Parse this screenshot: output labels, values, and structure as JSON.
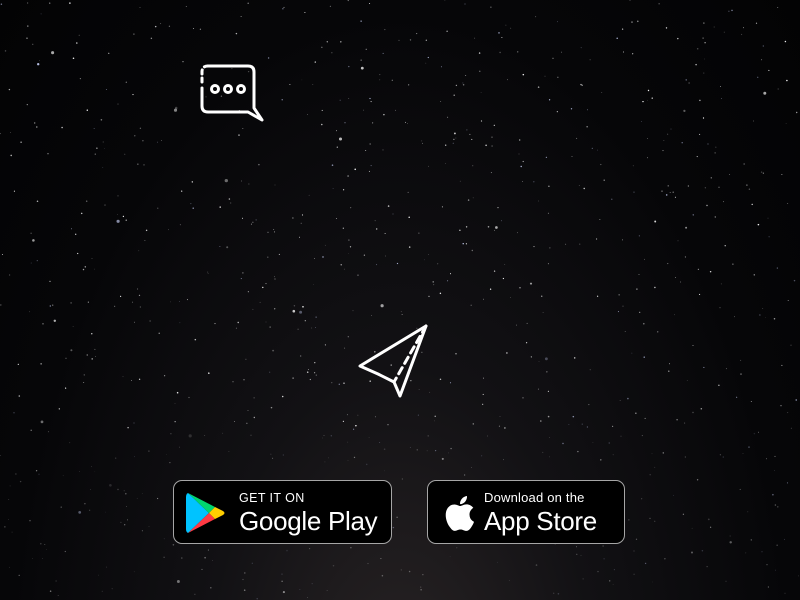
{
  "icons": {
    "chat": "chat-bubble-icon",
    "plane": "paper-plane-icon",
    "google_logo": "google-play-logo-icon",
    "apple_logo": "apple-logo-icon"
  },
  "badges": {
    "google_play": {
      "small_label": "GET IT ON",
      "big_label": "Google Play"
    },
    "app_store": {
      "small_label": "Download on the",
      "big_label": "App Store"
    }
  },
  "colors": {
    "background": "#050507",
    "icon_stroke": "#ffffff",
    "badge_border": "#a6a6a6",
    "play_green": "#00d66f",
    "play_blue": "#00c3ff",
    "play_yellow": "#ffce00",
    "play_red": "#ff3a44"
  }
}
